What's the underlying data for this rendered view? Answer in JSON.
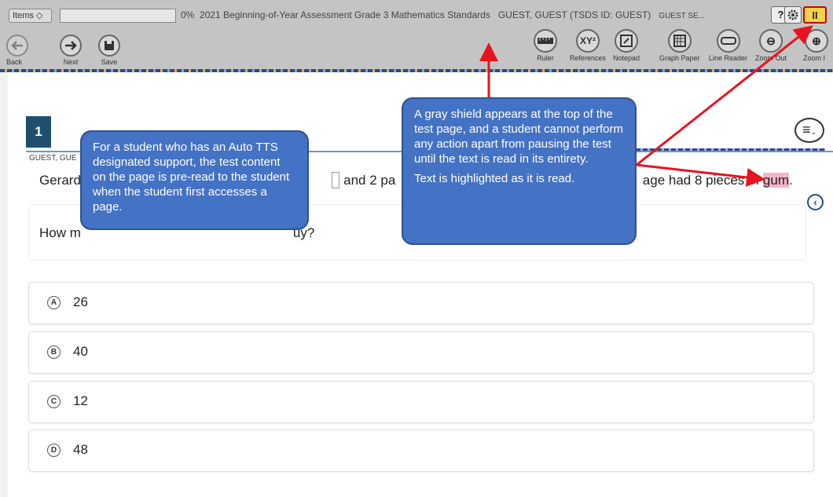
{
  "toolbar": {
    "items_label": "Items",
    "progress": "0%",
    "test_title": "2021 Beginning-of-Year Assessment Grade 3 Mathematics Standards",
    "student": "GUEST, GUEST (TSDS ID: GUEST)",
    "session": "GUEST SE...",
    "help": "?",
    "pause": "II",
    "back": "Back",
    "next": "Next",
    "save": "Save",
    "tools": [
      "Ruler",
      "References",
      "Notepad",
      "Graph Paper",
      "Line Reader",
      "Zoom Out",
      "Zoom I"
    ]
  },
  "question": {
    "number": "1",
    "student_name": "GUEST, GUE",
    "stem_part1": "Gerard",
    "stem_part2": "and 2 pa",
    "stem_part3": "age had 8 pieces of",
    "stem_gum": "gum",
    "stem_end": ".",
    "stem_q_start": "How m",
    "stem_q_end": "uy?",
    "choices": [
      {
        "letter": "A",
        "value": "26"
      },
      {
        "letter": "B",
        "value": "40"
      },
      {
        "letter": "C",
        "value": "12"
      },
      {
        "letter": "D",
        "value": "48"
      }
    ]
  },
  "callouts": {
    "auto_tts": "For a student who has an Auto TTS designated support, the test content on the page is pre-read to the student when the student first accesses a page.",
    "shield_text": "A gray shield appears at the top of the test page, and a student cannot perform any action apart from pausing the test until the text is read in its entirety.",
    "highlight_text": "Text is highlighted as it is read."
  },
  "colors": {
    "shield_gray": "#c4c4c4",
    "callout_blue": "#4472c4",
    "arrow_red": "#e8131e",
    "highlight_pink": "#f6b4c8"
  }
}
